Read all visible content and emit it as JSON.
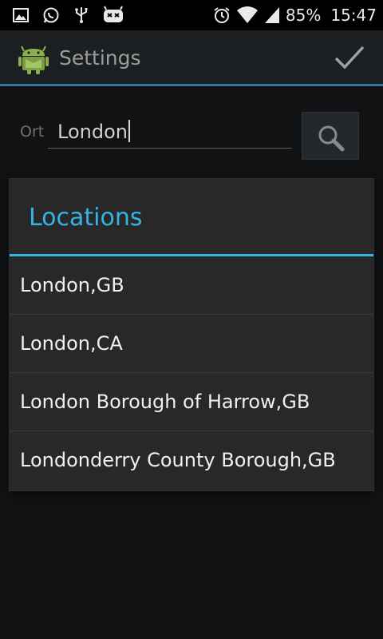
{
  "status_bar": {
    "battery": "85%",
    "time": "15:47",
    "left_icons": [
      "gallery-icon",
      "whatsapp-icon",
      "usb-icon",
      "cyanogenmod-icon"
    ],
    "right_icons": [
      "alarm-icon",
      "wifi-icon",
      "signal-icon"
    ]
  },
  "action_bar": {
    "title": "Settings",
    "icon": "android-app-icon",
    "action": "checkmark-icon"
  },
  "search": {
    "label": "Ort",
    "value": "London",
    "button_icon": "search-icon"
  },
  "dialog": {
    "title": "Locations",
    "items": [
      {
        "label": "London,GB"
      },
      {
        "label": "London,CA"
      },
      {
        "label": "London Borough of Harrow,GB"
      },
      {
        "label": "Londonderry County Borough,GB"
      }
    ]
  },
  "colors": {
    "accent": "#33b5e5",
    "action_bar_divider": "#2f7a9c",
    "background": "#101214"
  }
}
